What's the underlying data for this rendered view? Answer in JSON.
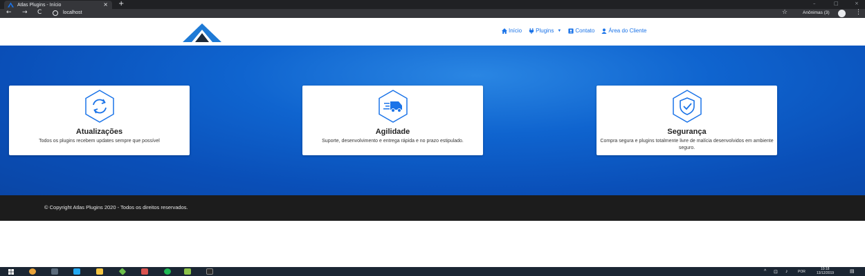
{
  "browser": {
    "tab_title": "Atlas Plugins - Início",
    "tab_close": "×",
    "new_tab": "+",
    "back": "←",
    "forward": "→",
    "reload": "C",
    "url": "localhost",
    "bookmark_star": "☆",
    "profile_name": "Anônimas (3)",
    "menu": "⋮",
    "window_controls": [
      "–",
      "□",
      "×"
    ]
  },
  "site": {
    "nav": [
      {
        "label": "Início",
        "icon": "home-icon"
      },
      {
        "label": "Plugins",
        "icon": "plug-icon",
        "dropdown": true
      },
      {
        "label": "Contato",
        "icon": "contact-card-icon"
      },
      {
        "label": "Área do Cliente",
        "icon": "user-icon"
      }
    ],
    "cards": [
      {
        "title": "Atualizações",
        "description": "Todos os plugins recebem updates sempre que possível",
        "icon": "refresh-icon"
      },
      {
        "title": "Agilidade",
        "description": "Suporte, desenvolvimento e entrega rápida e no prazo estipulado.",
        "icon": "delivery-truck-icon"
      },
      {
        "title": "Segurança",
        "description": "Compra segura e plugins totalmente livre de malícia desenvolvidos em ambiente seguro.",
        "icon": "shield-check-icon"
      }
    ],
    "footer": "© Copyright Atlas Plugins 2020 - Todos os direitos reservados."
  },
  "taskbar": {
    "tray_lang": "POR",
    "time": "10:18",
    "date": "13/12/2019"
  },
  "colors": {
    "brand_blue": "#1a73e8",
    "hero_blue": "#0f64cf",
    "footer_bg": "#1c1c1c"
  }
}
